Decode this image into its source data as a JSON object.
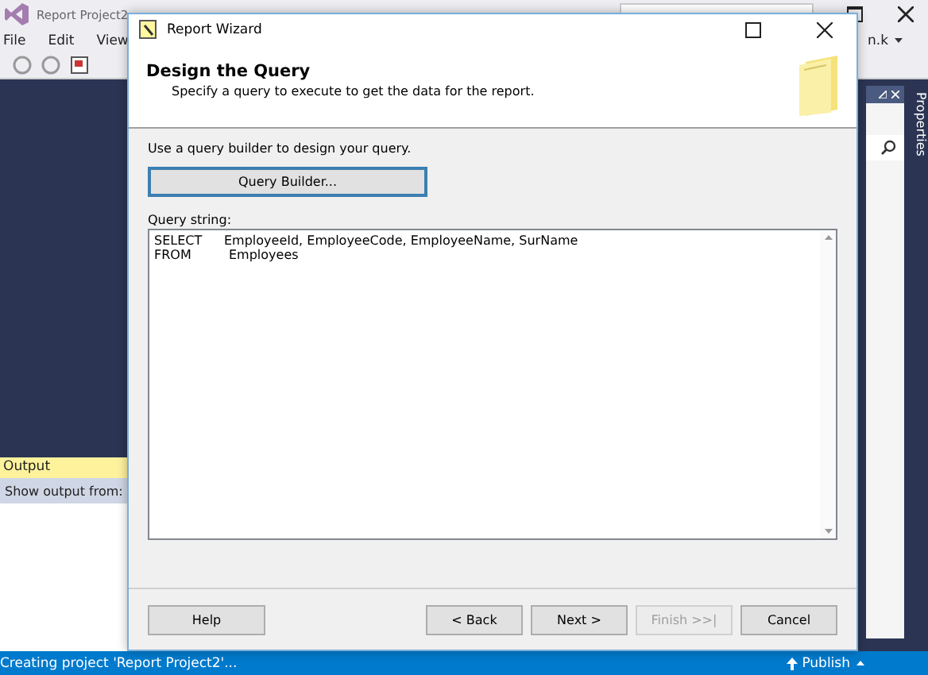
{
  "ide": {
    "title": "Report Project2",
    "menu": [
      "File",
      "Edit",
      "View"
    ],
    "user": "n.k",
    "side_tab": "Properties",
    "output_panel": {
      "title": "Output",
      "show_from_label": "Show output from:"
    },
    "status_bar": {
      "message": "Creating project 'Report Project2'...",
      "publish": "Publish"
    }
  },
  "dialog": {
    "title": "Report Wizard",
    "heading": "Design the Query",
    "subtitle": "Specify a query to execute to get the data for the report.",
    "instruction": "Use a query builder to design your query.",
    "query_builder_button": "Query Builder...",
    "query_label": "Query string:",
    "query_lines": [
      {
        "keyword": "SELECT",
        "text": "EmployeeId, EmployeeCode, EmployeeName, SurName"
      },
      {
        "keyword": "FROM",
        "text": "Employees"
      }
    ],
    "buttons": [
      {
        "label": "Help",
        "kind": "left",
        "disabled": false
      },
      {
        "label": "< Back",
        "kind": "right",
        "disabled": false
      },
      {
        "label": "Next >",
        "kind": "right",
        "disabled": false
      },
      {
        "label": "Finish >>|",
        "kind": "right",
        "disabled": true
      },
      {
        "label": "Cancel",
        "kind": "right",
        "disabled": false
      }
    ]
  }
}
